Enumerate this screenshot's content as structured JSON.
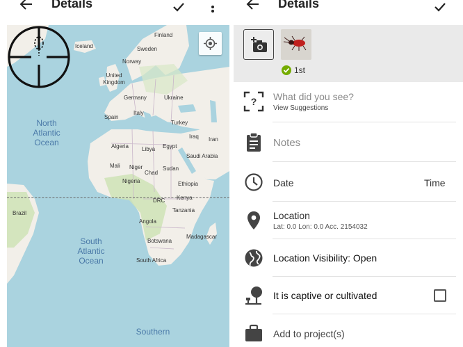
{
  "left": {
    "title": "Details",
    "map": {
      "countries": [
        "Finland",
        "Sweden",
        "Norway",
        "Iceland",
        "United Kingdom",
        "Germany",
        "Ukraine",
        "Italy",
        "Spain",
        "Turkey",
        "Iraq",
        "Iran",
        "Algeria",
        "Libya",
        "Egypt",
        "Saudi Arabia",
        "Mali",
        "Niger",
        "Chad",
        "Sudan",
        "Nigeria",
        "Ethiopia",
        "DRC",
        "Kenya",
        "Tanzania",
        "Angola",
        "Brazil",
        "Botswana",
        "Madagascar",
        "South Africa"
      ],
      "oceans": [
        "North Atlantic Ocean",
        "South Atlantic Ocean",
        "Southern"
      ]
    }
  },
  "right": {
    "title": "Details",
    "photo_label": "1st",
    "what_label": "What did you see?",
    "what_sub": "View Suggestions",
    "notes_label": "Notes",
    "date_label": "Date",
    "time_label": "Time",
    "location_label": "Location",
    "location_sub": "Lat: 0.0 Lon: 0.0 Acc. 2154032",
    "visibility_label": "Location Visibility: Open",
    "captive_label": "It is captive or cultivated",
    "project_label": "Add to project(s)"
  },
  "colors": {
    "accent": "#74ac00",
    "icon": "#444444",
    "divider": "#e2e2e2",
    "ocean": "#aad3df",
    "land": "#f2efe9"
  },
  "icons": [
    "back-arrow-icon",
    "check-icon",
    "more-vert-icon",
    "my-location-icon",
    "crosshair-icon",
    "add-photo-icon",
    "help-icon",
    "clipboard-icon",
    "clock-icon",
    "location-pin-icon",
    "globe-icon",
    "captive-plant-icon",
    "briefcase-icon"
  ]
}
